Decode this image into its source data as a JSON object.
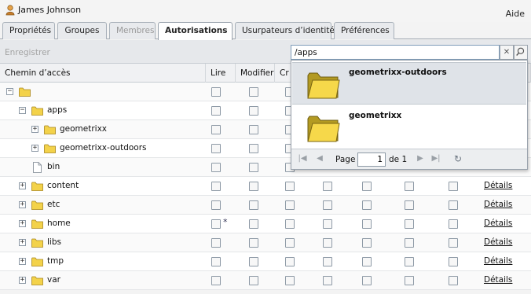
{
  "header": {
    "user_name": "James Johnson",
    "help": "Aide"
  },
  "tabs": [
    {
      "label": "Propriétés",
      "state": "normal"
    },
    {
      "label": "Groupes",
      "state": "normal"
    },
    {
      "label": "Membres",
      "state": "disabled"
    },
    {
      "label": "Autorisations",
      "state": "active"
    },
    {
      "label": "Usurpateurs d’identité",
      "state": "normal"
    },
    {
      "label": "Préférences",
      "state": "normal"
    }
  ],
  "toolbar": {
    "save_label": "Enregistrer",
    "search_value": "/apps"
  },
  "table": {
    "columns": [
      "Chemin d’accès",
      "Lire",
      "Modifier",
      "Cr"
    ],
    "details_label": "Détails",
    "rows": [
      {
        "label": "",
        "type": "folder",
        "expander": "minus"
      },
      {
        "label": "apps",
        "type": "folder",
        "expander": "minus"
      },
      {
        "label": "geometrixx",
        "type": "folder",
        "expander": "plus"
      },
      {
        "label": "geometrixx-outdoors",
        "type": "folder",
        "expander": "plus"
      },
      {
        "label": "bin",
        "type": "file",
        "expander": "none"
      },
      {
        "label": "content",
        "type": "folder",
        "expander": "plus"
      },
      {
        "label": "etc",
        "type": "folder",
        "expander": "plus"
      },
      {
        "label": "home",
        "type": "folder",
        "expander": "plus",
        "star": "*"
      },
      {
        "label": "libs",
        "type": "folder",
        "expander": "plus"
      },
      {
        "label": "tmp",
        "type": "folder",
        "expander": "plus"
      },
      {
        "label": "var",
        "type": "folder",
        "expander": "plus"
      }
    ]
  },
  "dropdown": {
    "items": [
      {
        "label": "geometrixx-outdoors",
        "selected": true
      },
      {
        "label": "geometrixx",
        "selected": false
      }
    ],
    "pager": {
      "page_label": "Page",
      "page_value": "1",
      "of_label": "de 1"
    }
  },
  "colors": {
    "folder": "#f3d24a",
    "tab_border": "#a9b1ba",
    "selected_item": "#dfe3e8"
  }
}
